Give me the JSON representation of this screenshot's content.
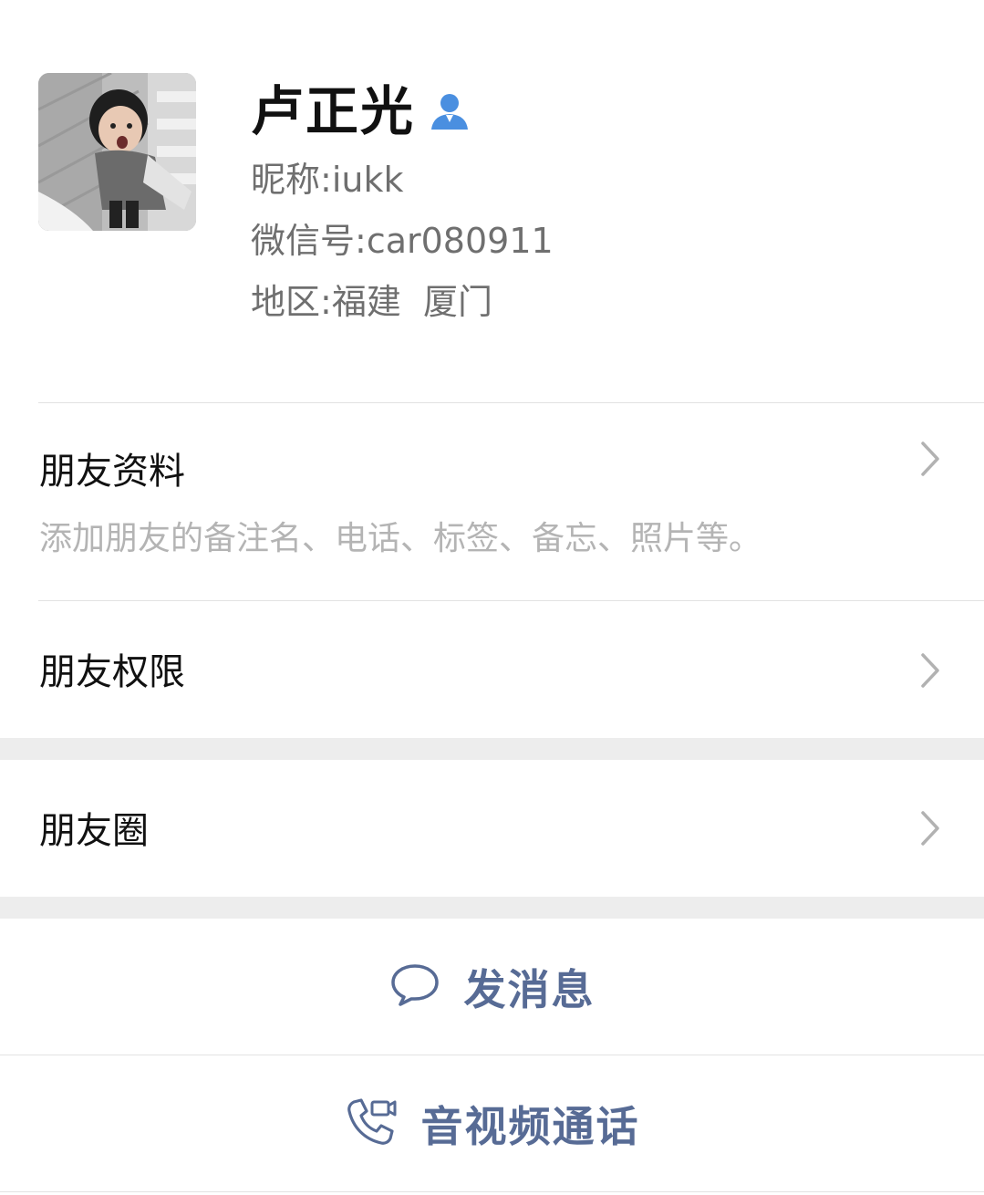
{
  "profile": {
    "name": "卢正光",
    "nickname_label": "昵称:",
    "nickname": "iukk",
    "wechat_id_label": "微信号:",
    "wechat_id": "car080911",
    "region_label": "地区:",
    "region": "福建  厦门",
    "avatar_icon": "avatar-photo",
    "contact_icon": "person-icon"
  },
  "rows": {
    "profile_info": {
      "title": "朋友资料",
      "subtitle": "添加朋友的备注名、电话、标签、备忘、照片等。"
    },
    "permissions": {
      "title": "朋友权限"
    },
    "moments": {
      "title": "朋友圈"
    }
  },
  "actions": {
    "message": {
      "label": "发消息",
      "icon": "chat-bubble-icon"
    },
    "call": {
      "label": "音视频通话",
      "icon": "phone-video-icon"
    }
  },
  "colors": {
    "link": "#576b95",
    "accent_icon": "#4a8fe0",
    "separator": "#ededed",
    "secondary_text": "#6f6f6f",
    "hint_text": "#b4b4b4"
  }
}
